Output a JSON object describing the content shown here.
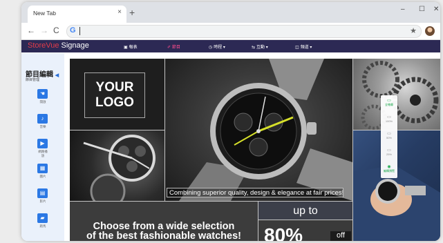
{
  "browser": {
    "tab_title": "New Tab",
    "tab_close": "×",
    "new_tab": "+",
    "minimize": "–",
    "maximize": "☐",
    "close": "✕",
    "back": "←",
    "forward": "→",
    "reload": "C",
    "address_icon": "G",
    "bookmark": "★",
    "menu": "⋮"
  },
  "app": {
    "logo_part1": "StoreVue",
    "logo_part2": " Signage",
    "menu": [
      {
        "icon": "▣",
        "label": "報表"
      },
      {
        "icon": "✐",
        "label": "節目"
      },
      {
        "icon": "◷",
        "label": "時程 ▾"
      },
      {
        "icon": "⇆",
        "label": "互動 ▾"
      },
      {
        "icon": "◫",
        "label": "頻道 ▾"
      }
    ]
  },
  "sidebar": {
    "title": "節目編輯",
    "pin": "◀",
    "subtitle": "節目管理",
    "tools": [
      {
        "icon": "☚",
        "label": "開啟"
      },
      {
        "icon": "♪",
        "label": "音樂"
      },
      {
        "icon": "▶",
        "label": "網路播放"
      },
      {
        "icon": "▦",
        "label": "圖片"
      },
      {
        "icon": "▤",
        "label": "影片"
      },
      {
        "icon": "▰",
        "label": "跑馬"
      }
    ]
  },
  "canvas": {
    "logo_text_1": "YOUR",
    "logo_text_2": "LOGO",
    "caption": "Combining superior quality, design & elegance at fair prices!",
    "choose_line1": "Choose from a wide selection",
    "choose_line2": "of the best fashionable watches!",
    "up_to": "up to",
    "percent": "80%",
    "off": "off"
  },
  "float_panel": {
    "items": [
      {
        "icon": "▭",
        "label": "全螢幕"
      },
      {
        "icon": "▭",
        "label": "100%"
      },
      {
        "icon": "▭",
        "label": "50%"
      },
      {
        "icon": "▭",
        "label": "25%"
      },
      {
        "icon": "◉",
        "label": "編輯預覽"
      }
    ]
  },
  "colors": {
    "appbar": "#2c2954",
    "logo_accent": "#e23c4a",
    "menu_active": "#ff4d8d",
    "tool_blue": "#2b78e4"
  }
}
